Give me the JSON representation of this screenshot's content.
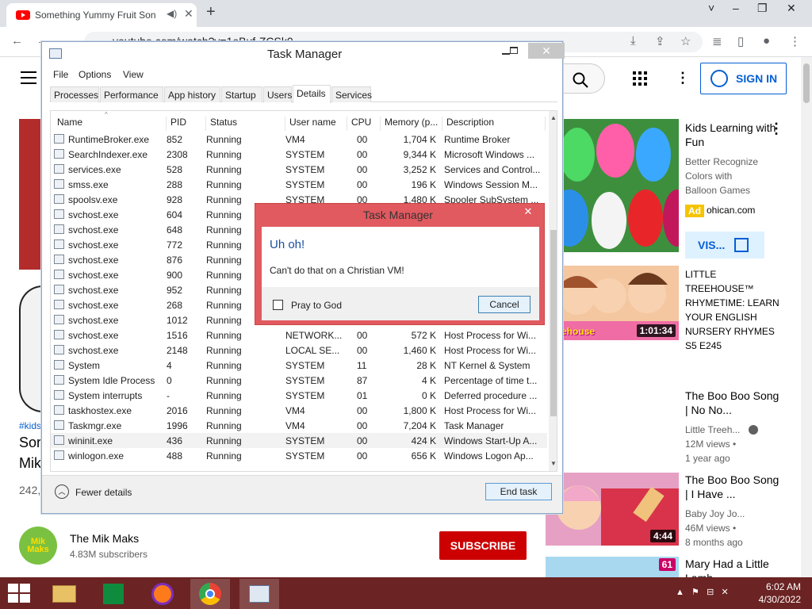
{
  "browser": {
    "tab_title": "Something Yummy Fruit Son",
    "tab_sound_icon": "speaker-icon",
    "url": "youtube.com/watch?v=1oBuf-ZCSk0",
    "window_controls": [
      "˅",
      "–",
      "❐",
      "✕"
    ]
  },
  "youtube": {
    "sign_in": "SIGN IN",
    "hashtag": "#kids",
    "title_line1": "Sor",
    "title_line2": "Mik",
    "views": "242,",
    "channel": {
      "name": "The Mik Maks",
      "subs": "4.83M subscribers",
      "avatar_text": "Mik Maks"
    },
    "subscribe": "SUBSCRIBE",
    "recommended": [
      {
        "title": "Kids Learning with Fun",
        "meta1": "Better Recognize",
        "meta2": "Colors with",
        "meta3": "Balloon Games",
        "ad": "Ad",
        "domain": "ohican.com",
        "visit": "VIS..."
      },
      {
        "title": "LITTLE TREEHOUSE™ RHYMETIME: LEARN YOUR ENGLISH NURSERY RHYMES  S5 E245",
        "duration": "1:01:34",
        "brand": "Treehouse"
      },
      {
        "title": "The Boo Boo Song | No No...",
        "meta1": "Little Treeh...",
        "meta2": "12M views •",
        "meta3": "1 year ago"
      },
      {
        "title": "The Boo Boo Song | I Have ...",
        "meta1": "Baby Joy Jo...",
        "meta2": "46M views •",
        "meta3": "8 months ago",
        "duration": "4:44"
      },
      {
        "title": "Mary Had a Little Lamb",
        "duration": "61"
      }
    ]
  },
  "taskmanager": {
    "title": "Task Manager",
    "menu": [
      "File",
      "Options",
      "View"
    ],
    "tabs": [
      "Processes",
      "Performance",
      "App history",
      "Startup",
      "Users",
      "Details",
      "Services"
    ],
    "active_tab": "Details",
    "columns": [
      "Name",
      "PID",
      "Status",
      "User name",
      "CPU",
      "Memory (p...",
      "Description"
    ],
    "rows": [
      [
        "RuntimeBroker.exe",
        "852",
        "Running",
        "VM4",
        "00",
        "1,704 K",
        "Runtime Broker"
      ],
      [
        "SearchIndexer.exe",
        "2308",
        "Running",
        "SYSTEM",
        "00",
        "9,344 K",
        "Microsoft Windows ..."
      ],
      [
        "services.exe",
        "528",
        "Running",
        "SYSTEM",
        "00",
        "3,252 K",
        "Services and Control..."
      ],
      [
        "smss.exe",
        "288",
        "Running",
        "SYSTEM",
        "00",
        "196 K",
        "Windows Session M..."
      ],
      [
        "spoolsv.exe",
        "928",
        "Running",
        "SYSTEM",
        "00",
        "1,480 K",
        "Spooler SubSystem ..."
      ],
      [
        "svchost.exe",
        "604",
        "Running",
        "",
        "",
        "",
        ""
      ],
      [
        "svchost.exe",
        "648",
        "Running",
        "",
        "",
        "",
        ""
      ],
      [
        "svchost.exe",
        "772",
        "Running",
        "",
        "",
        "",
        ""
      ],
      [
        "svchost.exe",
        "876",
        "Running",
        "",
        "",
        "",
        ""
      ],
      [
        "svchost.exe",
        "900",
        "Running",
        "",
        "",
        "",
        ""
      ],
      [
        "svchost.exe",
        "952",
        "Running",
        "",
        "",
        "",
        ""
      ],
      [
        "svchost.exe",
        "268",
        "Running",
        "",
        "",
        "",
        ""
      ],
      [
        "svchost.exe",
        "1012",
        "Running",
        "",
        "",
        "",
        ""
      ],
      [
        "svchost.exe",
        "1516",
        "Running",
        "NETWORK...",
        "00",
        "572 K",
        "Host Process for Wi..."
      ],
      [
        "svchost.exe",
        "2148",
        "Running",
        "LOCAL SE...",
        "00",
        "1,460 K",
        "Host Process for Wi..."
      ],
      [
        "System",
        "4",
        "Running",
        "SYSTEM",
        "11",
        "28 K",
        "NT Kernel & System"
      ],
      [
        "System Idle Process",
        "0",
        "Running",
        "SYSTEM",
        "87",
        "4 K",
        "Percentage of time t..."
      ],
      [
        "System interrupts",
        "-",
        "Running",
        "SYSTEM",
        "01",
        "0 K",
        "Deferred procedure ..."
      ],
      [
        "taskhostex.exe",
        "2016",
        "Running",
        "VM4",
        "00",
        "1,800 K",
        "Host Process for Wi..."
      ],
      [
        "Taskmgr.exe",
        "1996",
        "Running",
        "VM4",
        "00",
        "7,204 K",
        "Task Manager"
      ],
      [
        "wininit.exe",
        "436",
        "Running",
        "SYSTEM",
        "00",
        "424 K",
        "Windows Start-Up A..."
      ],
      [
        "winlogon.exe",
        "488",
        "Running",
        "SYSTEM",
        "00",
        "656 K",
        "Windows Logon Ap..."
      ]
    ],
    "selected_row": "wininit.exe",
    "fewer_details": "Fewer details",
    "end_task": "End task"
  },
  "dialog": {
    "title": "Task Manager",
    "heading": "Uh oh!",
    "message": "Can't do that on a Christian VM!",
    "checkbox_label": "Pray to God",
    "checkbox_checked": false,
    "cancel": "Cancel"
  },
  "taskbar": {
    "clock_time": "6:02 AM",
    "clock_date": "4/30/2022",
    "apps": [
      "file-explorer-icon",
      "store-icon",
      "firefox-icon",
      "chrome-icon",
      "task-manager-icon"
    ]
  },
  "colors": {
    "taskbar": "#6b2323",
    "dialog_border": "#e05a60",
    "youtube_red": "#cc0000",
    "link_blue": "#065fd4"
  }
}
